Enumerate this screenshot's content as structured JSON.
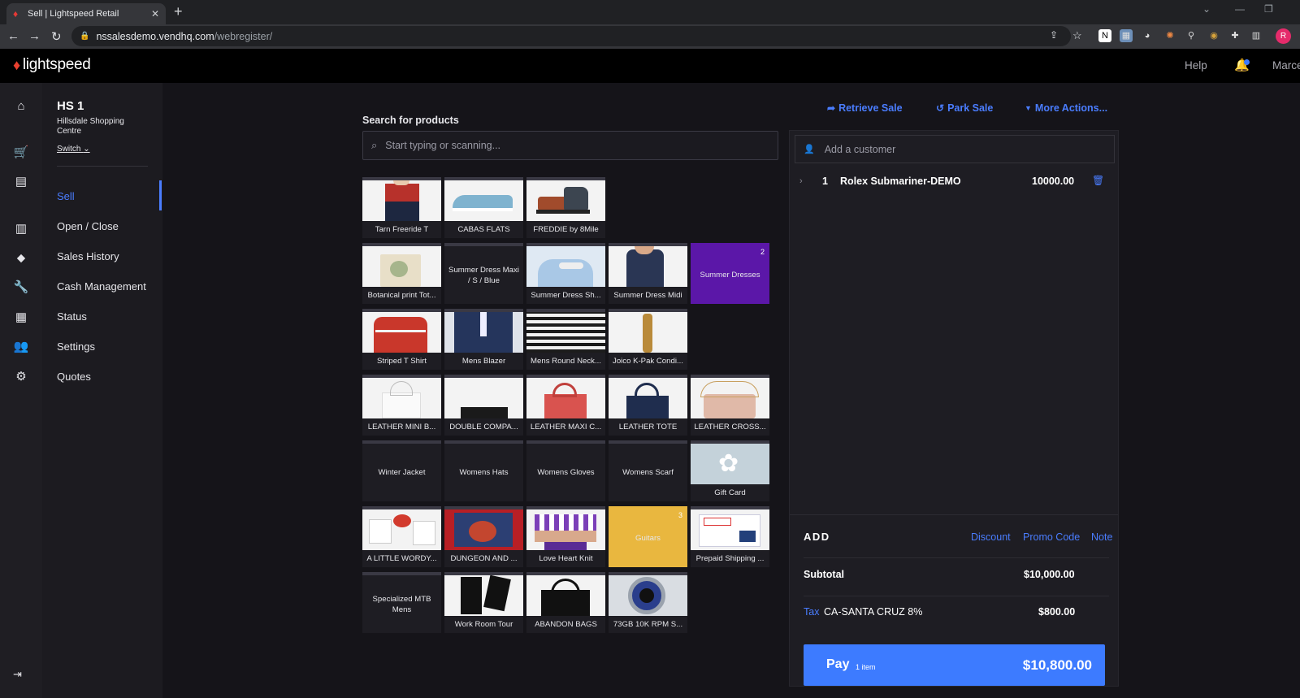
{
  "browser": {
    "tab_title": "Sell | Lightspeed Retail",
    "url_host": "nssalesdemo.vendhq.com",
    "url_path": "/webregister/",
    "profile_initial": "R"
  },
  "topbar": {
    "brand": "lightspeed",
    "help": "Help",
    "user": "Marce"
  },
  "outlet": {
    "code": "HS 1",
    "name": "Hillsdale Shopping Centre",
    "switch_label": "Switch"
  },
  "nav": [
    {
      "label": "Sell",
      "active": true
    },
    {
      "label": "Open / Close"
    },
    {
      "label": "Sales History"
    },
    {
      "label": "Cash Management"
    },
    {
      "label": "Status"
    },
    {
      "label": "Settings"
    },
    {
      "label": "Quotes"
    }
  ],
  "search": {
    "label": "Search for products",
    "placeholder": "Start typing or scanning..."
  },
  "tiles": [
    {
      "label": "Tarn Freeride T"
    },
    {
      "label": "CABAS FLATS"
    },
    {
      "label": "FREDDIE by 8Mile"
    },
    {
      "label": "Botanical print Tot..."
    },
    {
      "label": "Summer Dress Maxi / S / Blue"
    },
    {
      "label": "Summer Dress Sh..."
    },
    {
      "label": "Summer Dress Midi"
    },
    {
      "label": "Summer Dresses",
      "badge": "2"
    },
    {
      "label": "Striped T Shirt"
    },
    {
      "label": "Mens Blazer"
    },
    {
      "label": "Mens Round Neck..."
    },
    {
      "label": "Joico K-Pak Condi..."
    },
    {
      "label": "LEATHER MINI B..."
    },
    {
      "label": "DOUBLE COMPA..."
    },
    {
      "label": "LEATHER MAXI C..."
    },
    {
      "label": "LEATHER TOTE"
    },
    {
      "label": "LEATHER CROSS..."
    },
    {
      "label": "Winter Jacket"
    },
    {
      "label": "Womens Hats"
    },
    {
      "label": "Womens Gloves"
    },
    {
      "label": "Womens Scarf"
    },
    {
      "label": "Gift Card"
    },
    {
      "label": "A LITTLE WORDY..."
    },
    {
      "label": "DUNGEON AND ..."
    },
    {
      "label": "Love Heart Knit"
    },
    {
      "label": "Guitars",
      "badge": "3"
    },
    {
      "label": "Prepaid Shipping ..."
    },
    {
      "label": "Specialized MTB Mens"
    },
    {
      "label": "Work Room Tour"
    },
    {
      "label": "ABANDON BAGS"
    },
    {
      "label": "73GB 10K RPM S..."
    }
  ],
  "actions": {
    "retrieve": "Retrieve Sale",
    "park": "Park Sale",
    "more": "More Actions..."
  },
  "cart": {
    "customer_placeholder": "Add a customer",
    "line": {
      "qty": "1",
      "name": "Rolex Submariner-DEMO",
      "price": "10000.00"
    },
    "add_label": "ADD",
    "discount": "Discount",
    "promo": "Promo Code",
    "note": "Note",
    "subtotal_label": "Subtotal",
    "subtotal": "$10,000.00",
    "tax_label": "Tax",
    "tax_name": "CA-SANTA CRUZ 8%",
    "tax": "$800.00",
    "pay_label": "Pay",
    "pay_items": "1 item",
    "pay_total": "$10,800.00"
  },
  "colors": {
    "accent": "#4a7dff",
    "pay": "#3d7bff",
    "folder_purple": "#5b17a8",
    "folder_yellow": "#e9b73f"
  }
}
